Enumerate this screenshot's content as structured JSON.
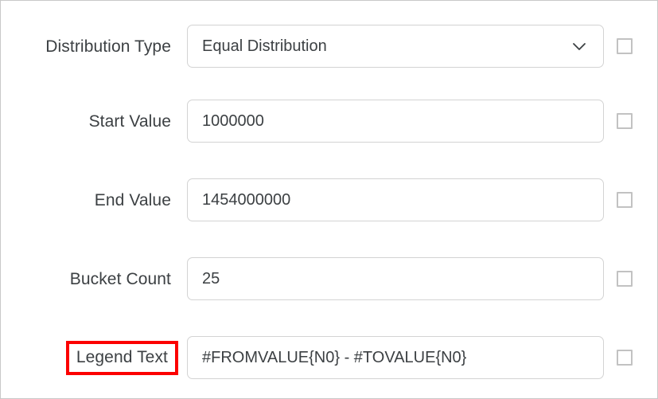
{
  "panel": {
    "accent_highlight_color": "#fc0000",
    "border_color": "#c8c8c8",
    "field_border_color": "#d3d3d3",
    "text_color": "#3c4043",
    "checkbox_border_color": "#c2c2c2"
  },
  "rows": [
    {
      "label": "Distribution Type",
      "value": "Equal Distribution",
      "placeholder": "",
      "type": "select",
      "highlighted": false,
      "checkbox_checked": false
    },
    {
      "label": "Start Value",
      "value": "1000000",
      "placeholder": "",
      "type": "text",
      "highlighted": false,
      "checkbox_checked": false
    },
    {
      "label": "End Value",
      "value": "1454000000",
      "placeholder": "",
      "type": "text",
      "highlighted": false,
      "checkbox_checked": false
    },
    {
      "label": "Bucket Count",
      "value": "25",
      "placeholder": "",
      "type": "text",
      "highlighted": false,
      "checkbox_checked": false
    },
    {
      "label": "Legend Text",
      "value": "#FROMVALUE{N0} - #TOVALUE{N0}",
      "placeholder": "",
      "type": "text",
      "highlighted": true,
      "checkbox_checked": false
    }
  ],
  "icons": {
    "dropdown": "chevron-down-icon",
    "checkbox": "checkbox-unchecked-icon"
  }
}
